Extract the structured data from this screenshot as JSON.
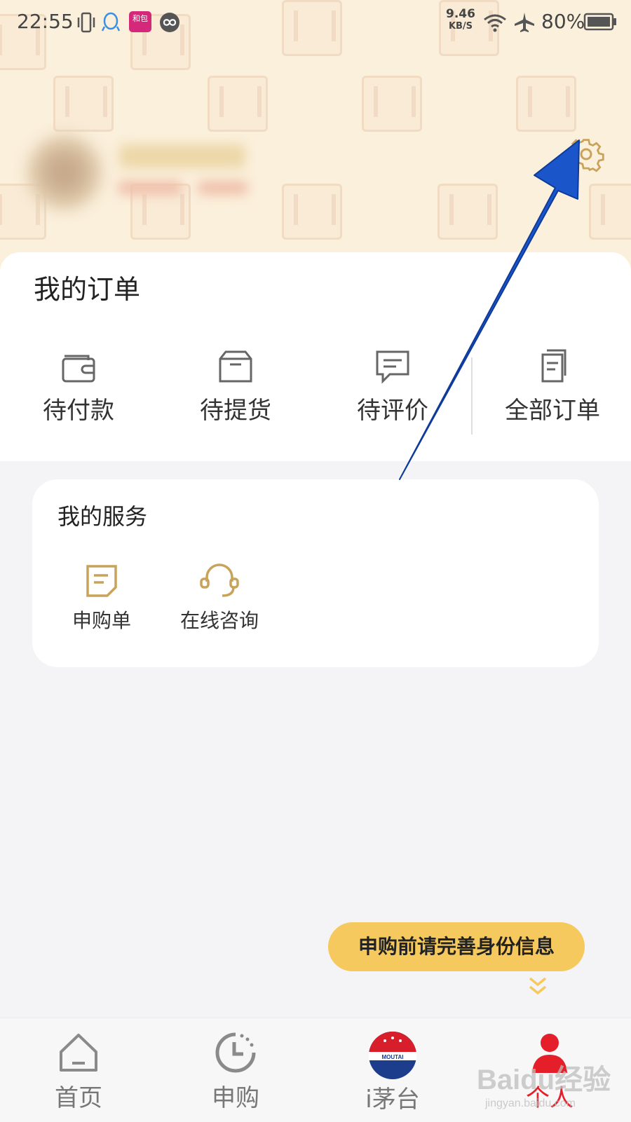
{
  "status_bar": {
    "time": "22:55",
    "net_speed_value": "9.46",
    "net_speed_unit": "KB/S",
    "battery": "80%",
    "notification_app_label": "和包"
  },
  "orders": {
    "title": "我的订单",
    "items": [
      {
        "label": "待付款",
        "icon": "wallet-icon"
      },
      {
        "label": "待提货",
        "icon": "box-icon"
      },
      {
        "label": "待评价",
        "icon": "comment-icon"
      },
      {
        "label": "全部订单",
        "icon": "document-icon"
      }
    ]
  },
  "services": {
    "title": "我的服务",
    "items": [
      {
        "label": "申购单",
        "icon": "form-icon"
      },
      {
        "label": "在线咨询",
        "icon": "headset-icon"
      }
    ]
  },
  "toast": "申购前请完善身份信息",
  "bottom_nav": [
    {
      "label": "首页",
      "icon": "home-icon"
    },
    {
      "label": "申购",
      "icon": "clock-icon"
    },
    {
      "label": "i茅台",
      "icon": "moutai-logo",
      "logo_text": "MOUTAI"
    },
    {
      "label": "个人",
      "icon": "user-icon",
      "active": true
    }
  ],
  "watermark": {
    "logo": "Baidu经验",
    "sub": "jingyan.baidu.com"
  },
  "colors": {
    "accent_gold": "#c9a35a",
    "toast_bg": "#f5c95e",
    "active_red": "#e41f2a",
    "header_bg": "#fbf0dc",
    "arrow_blue": "#1a56c9"
  }
}
